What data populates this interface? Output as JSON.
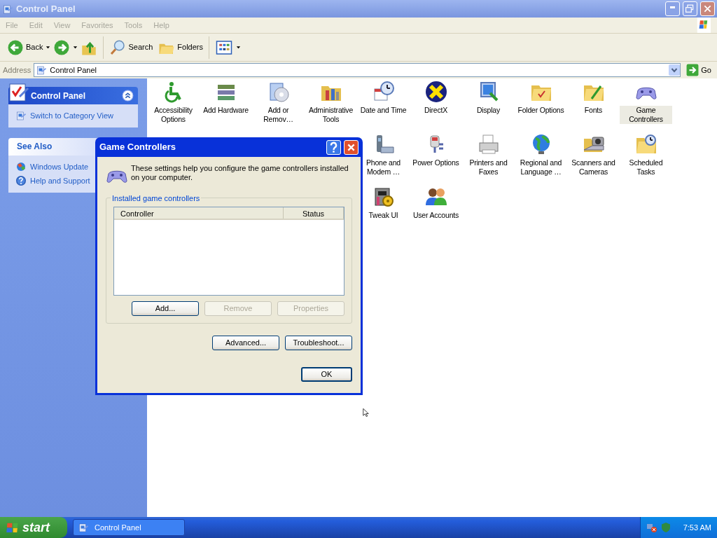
{
  "window": {
    "title": "Control Panel"
  },
  "menu": [
    "File",
    "Edit",
    "View",
    "Favorites",
    "Tools",
    "Help"
  ],
  "toolbar": [
    {
      "kind": "back",
      "label": "Back"
    },
    {
      "kind": "forward"
    },
    {
      "kind": "up"
    },
    {
      "kind": "search",
      "label": "Search"
    },
    {
      "kind": "folders",
      "label": "Folders"
    },
    {
      "kind": "views"
    }
  ],
  "address": {
    "label": "Address",
    "value": "Control Panel",
    "go": "Go"
  },
  "sidebar": [
    {
      "kind": "main",
      "title": "Control Panel",
      "items": [
        "Switch to Category View"
      ]
    },
    {
      "kind": "plain",
      "title": "See Also",
      "items": [
        "Windows Update",
        "Help and Support"
      ]
    }
  ],
  "icon_rows": [
    [
      {
        "label": "Accessibility Options",
        "selected": false
      },
      {
        "label": "Add Hardware",
        "selected": false
      },
      {
        "label": "Add or Remov…",
        "selected": false
      },
      {
        "label": "Administrative Tools",
        "selected": false
      },
      {
        "label": "Date and Time",
        "selected": false
      },
      {
        "label": "DirectX",
        "selected": false
      },
      {
        "label": "Display",
        "selected": false
      },
      {
        "label": "Folder Options",
        "selected": false
      },
      {
        "label": "Fonts",
        "selected": false
      },
      {
        "label": "Game Controllers",
        "selected": true
      }
    ],
    [
      {
        "label": "Phone and Modem …",
        "selected": false
      },
      {
        "label": "Power Options",
        "selected": false
      },
      {
        "label": "Printers and Faxes",
        "selected": false
      },
      {
        "label": "Regional and Language …",
        "selected": false
      },
      {
        "label": "Scanners and Cameras",
        "selected": false
      },
      {
        "label": "Scheduled Tasks",
        "selected": false
      }
    ],
    [
      {
        "label": "Tweak UI",
        "selected": false
      },
      {
        "label": "User Accounts",
        "selected": false
      }
    ]
  ],
  "dialog": {
    "title": "Game Controllers",
    "intro": "These settings help you configure the game controllers installed on your computer.",
    "group": "Installed game controllers",
    "columns": [
      "Controller",
      "Status"
    ],
    "buttons": [
      {
        "label": "Add...",
        "disabled": false
      },
      {
        "label": "Remove",
        "disabled": true
      },
      {
        "label": "Properties",
        "disabled": true
      }
    ],
    "actions": [
      "Advanced...",
      "Troubleshoot..."
    ],
    "ok": "OK"
  },
  "taskbar": {
    "start": "start",
    "tasks": [
      {
        "label": "Control Panel",
        "selected": false
      }
    ],
    "clock": "7:53 AM"
  }
}
